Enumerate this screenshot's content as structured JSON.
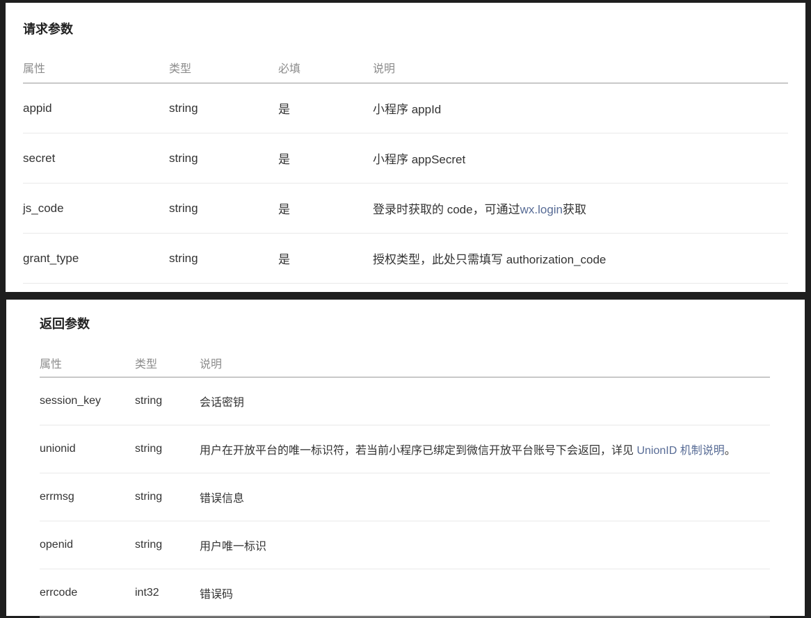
{
  "request": {
    "title": "请求参数",
    "headers": [
      "属性",
      "类型",
      "必填",
      "说明"
    ],
    "rows": [
      {
        "name": "appid",
        "type": "string",
        "required": "是",
        "desc_before": "小程序 appId",
        "link": "",
        "desc_after": ""
      },
      {
        "name": "secret",
        "type": "string",
        "required": "是",
        "desc_before": "小程序 appSecret",
        "link": "",
        "desc_after": ""
      },
      {
        "name": "js_code",
        "type": "string",
        "required": "是",
        "desc_before": "登录时获取的 code，可通过",
        "link": "wx.login",
        "desc_after": "获取"
      },
      {
        "name": "grant_type",
        "type": "string",
        "required": "是",
        "desc_before": "授权类型，此处只需填写 authorization_code",
        "link": "",
        "desc_after": ""
      }
    ]
  },
  "response": {
    "title": "返回参数",
    "headers": [
      "属性",
      "类型",
      "说明"
    ],
    "rows": [
      {
        "name": "session_key",
        "type": "string",
        "desc_before": "会话密钥",
        "link": "",
        "desc_after": ""
      },
      {
        "name": "unionid",
        "type": "string",
        "desc_before": "用户在开放平台的唯一标识符，若当前小程序已绑定到微信开放平台账号下会返回，详见 ",
        "link": "UnionID 机制说明",
        "desc_after": "。"
      },
      {
        "name": "errmsg",
        "type": "string",
        "desc_before": "错误信息",
        "link": "",
        "desc_after": ""
      },
      {
        "name": "openid",
        "type": "string",
        "desc_before": "用户唯一标识",
        "link": "",
        "desc_after": ""
      },
      {
        "name": "errcode",
        "type": "int32",
        "desc_before": "错误码",
        "link": "",
        "desc_after": ""
      }
    ]
  },
  "colors": {
    "link": "#576b95",
    "header_text": "#8c8c8c",
    "body_text": "#333333",
    "background": "#1e1e1e"
  }
}
